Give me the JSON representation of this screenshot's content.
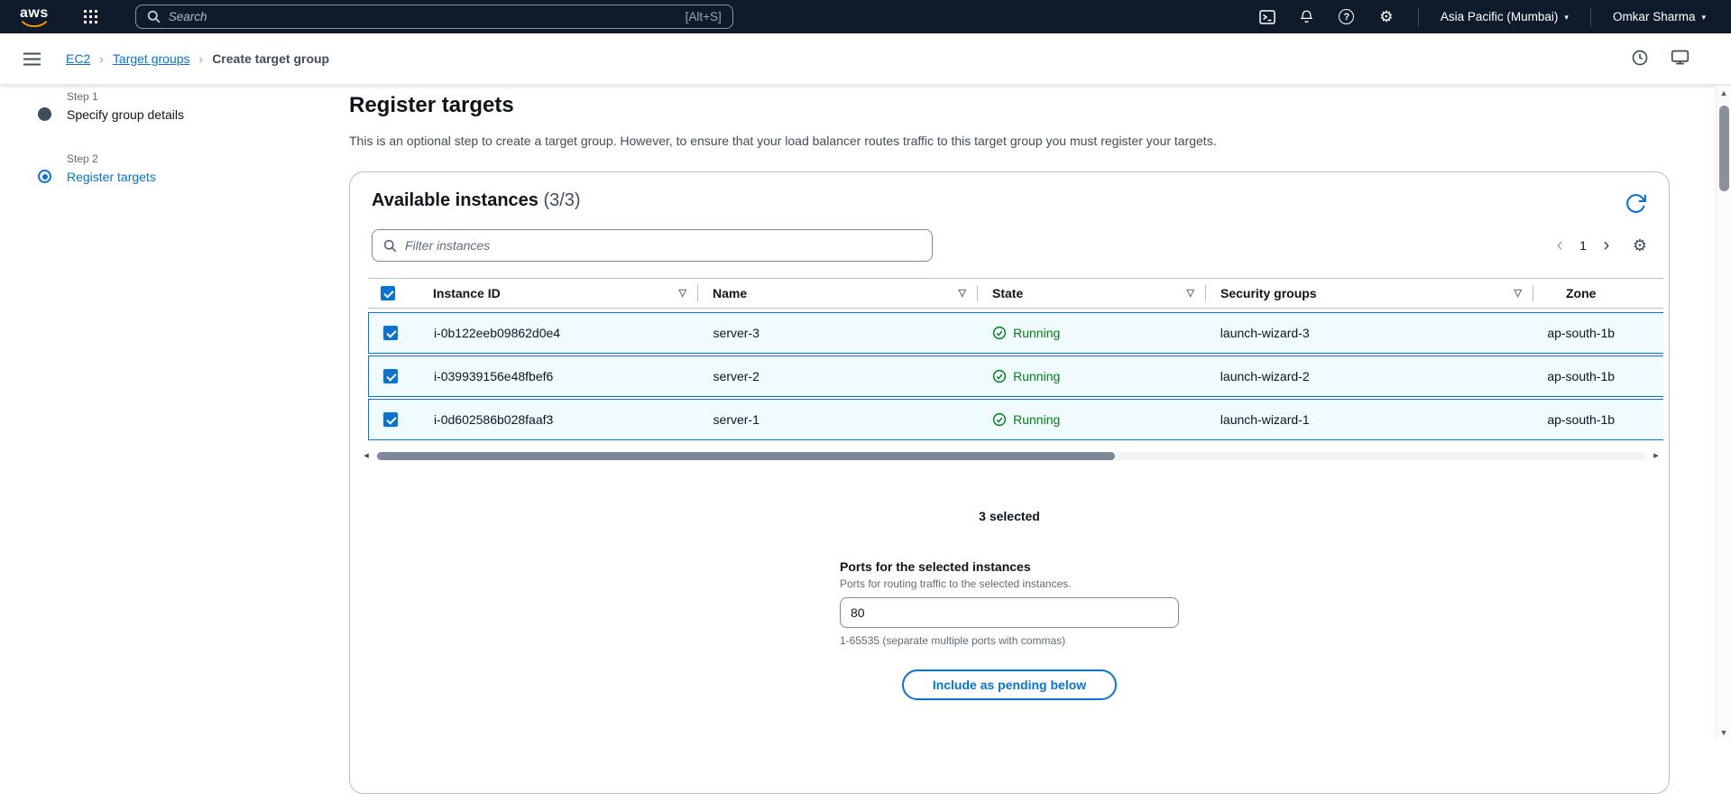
{
  "topbar": {
    "logo_text": "aws",
    "search_placeholder": "Search",
    "search_shortcut": "[Alt+S]",
    "region_label": "Asia Pacific (Mumbai)",
    "account_label": "Omkar Sharma"
  },
  "breadcrumb": {
    "items": [
      {
        "label": "EC2"
      },
      {
        "label": "Target groups"
      },
      {
        "label": "Create target group"
      }
    ]
  },
  "sidebar": {
    "steps": [
      {
        "step": "Step 1",
        "label": "Specify group details"
      },
      {
        "step": "Step 2",
        "label": "Register targets"
      }
    ]
  },
  "main": {
    "title": "Register targets",
    "description": "This is an optional step to create a target group. However, to ensure that your load balancer routes traffic to this target group you must register your targets.",
    "panel": {
      "title": "Available instances",
      "count": "(3/3)",
      "filter_placeholder": "Filter instances",
      "page_number": "1",
      "table": {
        "columns": [
          "Instance ID",
          "Name",
          "State",
          "Security groups",
          "Zone"
        ],
        "rows": [
          {
            "instance_id": "i-0b122eeb09862d0e4",
            "name": "server-3",
            "state": "Running",
            "security_groups": "launch-wizard-3",
            "zone": "ap-south-1b"
          },
          {
            "instance_id": "i-039939156e48fbef6",
            "name": "server-2",
            "state": "Running",
            "security_groups": "launch-wizard-2",
            "zone": "ap-south-1b"
          },
          {
            "instance_id": "i-0d602586b028faaf3",
            "name": "server-1",
            "state": "Running",
            "security_groups": "launch-wizard-1",
            "zone": "ap-south-1b"
          }
        ]
      },
      "selected_summary": "3 selected",
      "ports": {
        "label": "Ports for the selected instances",
        "description": "Ports for routing traffic to the selected instances.",
        "value": "80",
        "hint": "1-65535 (separate multiple ports with commas)",
        "button_label": "Include as pending below"
      }
    }
  },
  "icons": {
    "gear": "⚙",
    "caret_down": "▾",
    "help": "?",
    "sort": "▽",
    "breadcrumb_separator": "›",
    "chevron_left": "‹",
    "chevron_right": "›",
    "scroll_up": "▲",
    "scroll_down": "▼",
    "scroll_left": "◂",
    "scroll_right": "▸"
  },
  "colors": {
    "accent": "#0972d3",
    "topbar_bg": "#0f1b2a",
    "link": "#0972d3",
    "running_green": "#037f0c",
    "selected_row_bg": "#f0fbff",
    "selected_row_border": "#0972d3"
  }
}
